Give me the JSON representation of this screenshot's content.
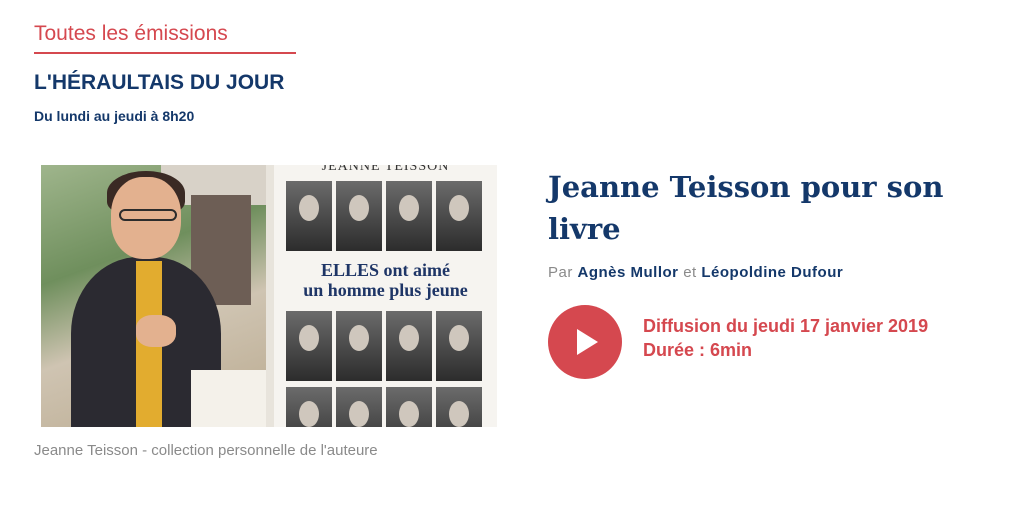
{
  "nav": {
    "back_label": "Toutes les émissions"
  },
  "show": {
    "title": "L'HÉRAULTAIS DU JOUR",
    "schedule": "Du lundi au jeudi à 8h20"
  },
  "image": {
    "book_author": "JEANNE TEISSON",
    "book_title_line1": "ELLES ont aimé",
    "book_title_line2": "un homme plus jeune",
    "caption": "Jeanne Teisson - collection personnelle de l'auteure"
  },
  "episode": {
    "title": "Jeanne Teisson pour son livre",
    "by_prefix": "Par",
    "author1": "Agnès Mullor",
    "conjunction": "et",
    "author2": "Léopoldine Dufour",
    "broadcast": "Diffusion du jeudi 17 janvier 2019",
    "duration": "Durée : 6min"
  },
  "colors": {
    "accent": "#d5484f",
    "navy": "#14386a",
    "muted": "#8a8a8a"
  },
  "icons": {
    "play": "play-icon"
  }
}
